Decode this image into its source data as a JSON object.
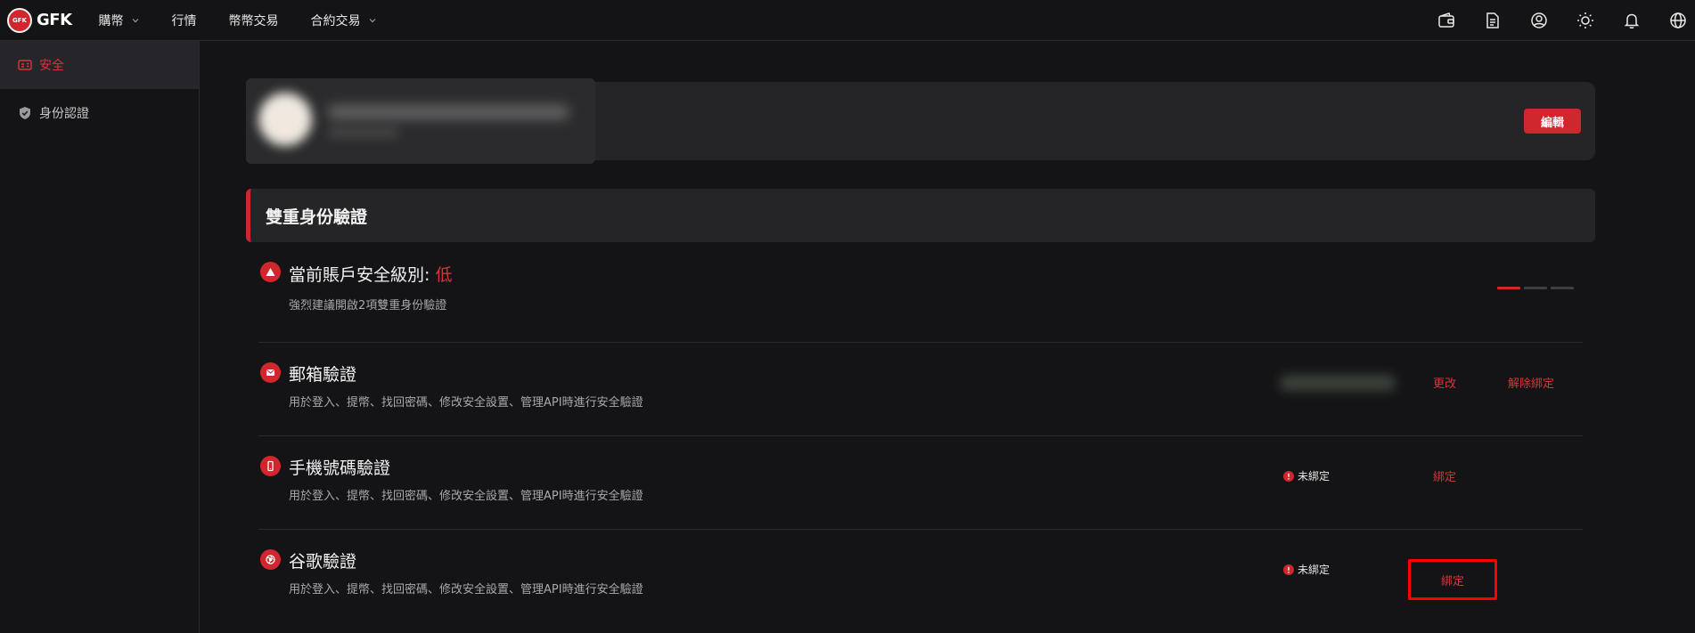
{
  "brand": {
    "logo_mark": "GFK",
    "name": "GFK",
    "accent_color": "#d0262d"
  },
  "nav": {
    "items": [
      {
        "label": "購幣",
        "has_dropdown": true
      },
      {
        "label": "行情",
        "has_dropdown": false
      },
      {
        "label": "幣幣交易",
        "has_dropdown": false
      },
      {
        "label": "合約交易",
        "has_dropdown": true
      }
    ],
    "icons": [
      "wallet-icon",
      "orders-document-icon",
      "user-account-icon",
      "theme-sun-icon",
      "notification-bell-icon",
      "language-globe-icon"
    ]
  },
  "sidebar": {
    "items": [
      {
        "label": "安全",
        "icon": "id-card-icon",
        "active": true
      },
      {
        "label": "身份認證",
        "icon": "shield-check-icon",
        "active": false
      }
    ]
  },
  "profile": {
    "edit_label": "編輯"
  },
  "two_factor": {
    "section_title": "雙重身份驗證",
    "security_level": {
      "title_prefix": "當前賬戶安全級別:",
      "level": "低",
      "description": "強烈建議開啟2項雙重身份驗證",
      "filled_bars": 1,
      "total_bars": 3
    },
    "methods": [
      {
        "title": "郵箱驗證",
        "icon": "email-icon",
        "description": "用於登入、提幣、找回密碼、修改安全設置、管理API時進行安全驗證",
        "status": "bound",
        "actions": [
          "更改",
          "解除綁定"
        ]
      },
      {
        "title": "手機號碼驗證",
        "icon": "mobile-phone-icon",
        "description": "用於登入、提幣、找回密碼、修改安全設置、管理API時進行安全驗證",
        "status_label": "未綁定",
        "actions": [
          "綁定"
        ]
      },
      {
        "title": "谷歌驗證",
        "icon": "google-authenticator-icon",
        "description": "用於登入、提幣、找回密碼、修改安全設置、管理API時進行安全驗證",
        "status_label": "未綁定",
        "actions": [
          "綁定"
        ]
      }
    ]
  }
}
